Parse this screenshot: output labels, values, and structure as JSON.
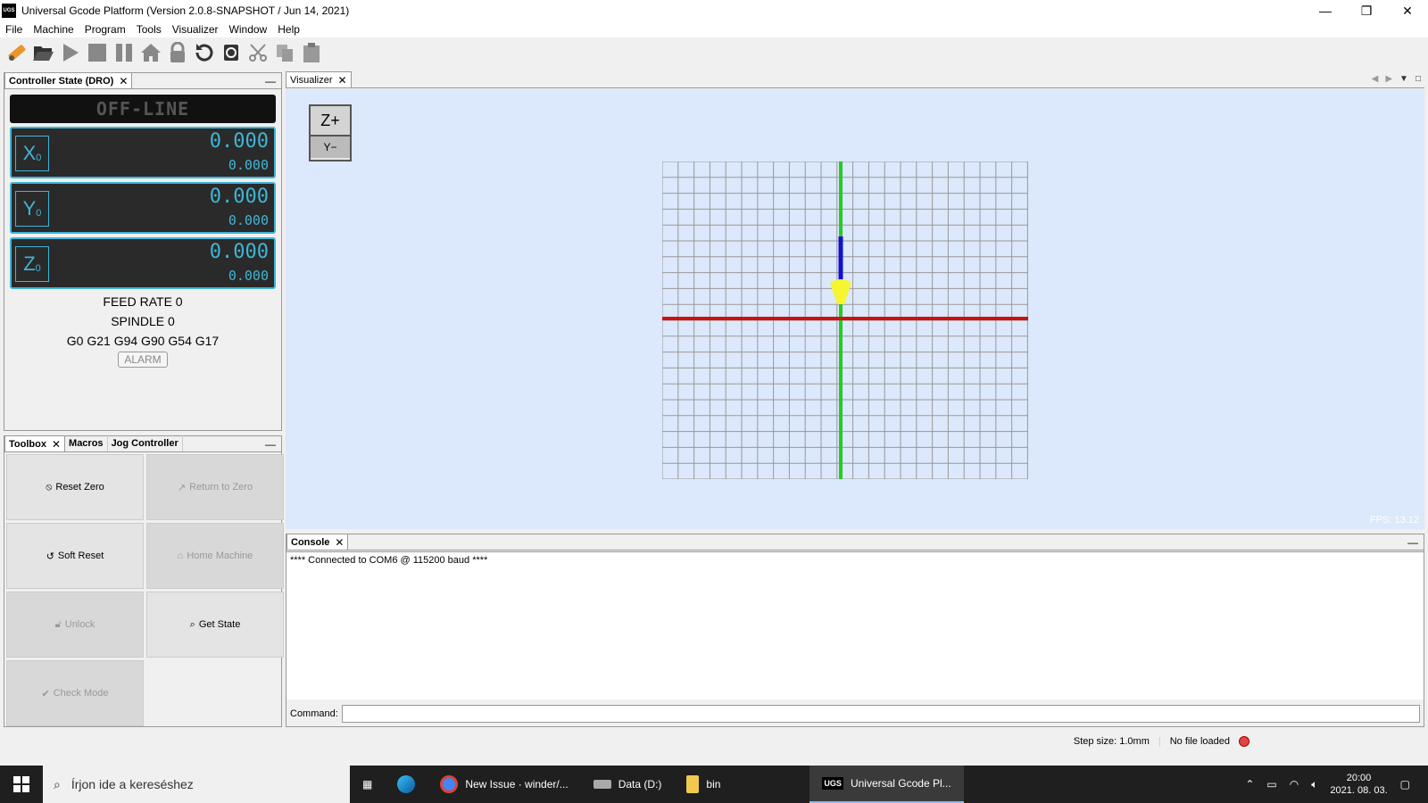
{
  "window": {
    "title": "Universal Gcode Platform (Version 2.0.8-SNAPSHOT / Jun 14, 2021)",
    "app_icon_label": "UGS",
    "controls": [
      "—",
      "❐",
      "✕"
    ]
  },
  "menu": [
    "File",
    "Machine",
    "Program",
    "Tools",
    "Visualizer",
    "Window",
    "Help"
  ],
  "toolbar": {
    "icons": [
      "connect-icon",
      "open-icon",
      "play-icon",
      "stop-icon",
      "pause-icon",
      "home-icon",
      "lock-icon",
      "reset-icon",
      "soft-reset-icon",
      "cut-icon",
      "copy-icon",
      "paste-icon"
    ]
  },
  "dro": {
    "tab": "Controller State (DRO)",
    "state": "OFF-LINE",
    "axes": [
      {
        "letter": "X",
        "sub": "0",
        "work": "0.000",
        "machine": "0.000"
      },
      {
        "letter": "Y",
        "sub": "0",
        "work": "0.000",
        "machine": "0.000"
      },
      {
        "letter": "Z",
        "sub": "0",
        "work": "0.000",
        "machine": "0.000"
      }
    ],
    "feed_rate": "FEED RATE 0",
    "spindle": "SPINDLE 0",
    "gcode_state": "G0 G21 G94 G90 G54 G17",
    "alarm": "ALARM"
  },
  "toolbox": {
    "tabs": [
      "Toolbox",
      "Macros",
      "Jog Controller"
    ],
    "buttons": [
      {
        "icon": "reset-zero-icon",
        "glyph": "⦸",
        "label": "Reset Zero",
        "enabled": true
      },
      {
        "icon": "return-zero-icon",
        "glyph": "↗",
        "label": "Return to Zero",
        "enabled": false
      },
      {
        "icon": "soft-reset-icon",
        "glyph": "↺",
        "label": "Soft Reset",
        "enabled": true
      },
      {
        "icon": "home-icon",
        "glyph": "⌂",
        "label": "Home Machine",
        "enabled": false
      },
      {
        "icon": "unlock-icon",
        "glyph": "ὑ3",
        "label": "Unlock",
        "enabled": false
      },
      {
        "icon": "magnifier-icon",
        "glyph": "⌕",
        "label": "Get State",
        "enabled": true
      },
      {
        "icon": "check-icon",
        "glyph": "✔",
        "label": "Check Mode",
        "enabled": false
      }
    ]
  },
  "visualizer": {
    "tab": "Visualizer",
    "navcube_top": "Z+",
    "navcube_bottom": "Y−",
    "fps": "FPS: 13.12",
    "colors": {
      "x_axis": "#cc1111",
      "y_axis": "#22cc22",
      "z_axis": "#1111cc",
      "tool": "#f5f532",
      "grid": "#999999",
      "background": "#dce8fb"
    }
  },
  "console": {
    "tab": "Console",
    "lines": [
      "**** Connected to COM6 @ 115200 baud ****"
    ],
    "command_label": "Command:"
  },
  "status": {
    "step_size": "Step size: 1.0mm",
    "file": "No file loaded"
  },
  "taskbar": {
    "search_placeholder": "Írjon ide a kereséshez",
    "items": [
      {
        "label": "New Issue · winder/...",
        "icon": "chrome-icon",
        "color": "#4285f4"
      },
      {
        "label": "Data (D:)",
        "icon": "drive-icon",
        "color": "#aaaaaa"
      },
      {
        "label": "bin",
        "icon": "folder-icon",
        "color": "#f2c94c"
      },
      {
        "label": "Universal Gcode Pl...",
        "icon": "ugs-icon",
        "color": "#000000"
      }
    ],
    "time": "20:00",
    "date": "2021. 08. 03."
  }
}
